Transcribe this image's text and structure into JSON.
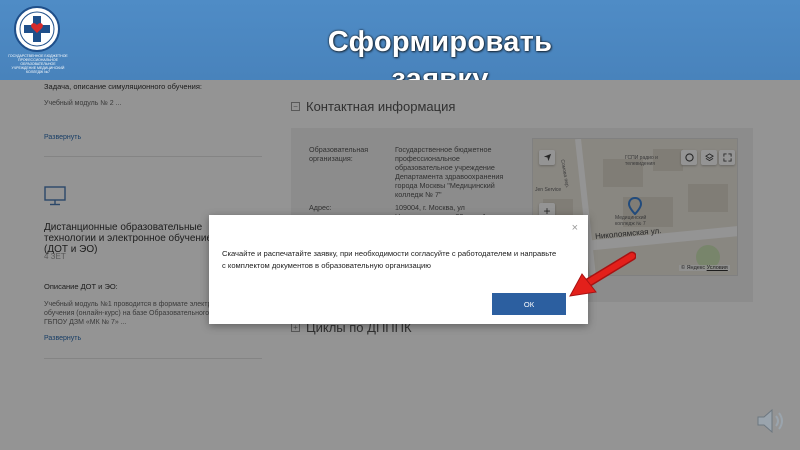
{
  "slide": {
    "title_line1": "Сформировать",
    "title_line2": "заявку",
    "logo_caption": "ГОСУДАРСТВЕННОЕ БЮДЖЕТНОЕ ПРОФЕССИОНАЛЬНОЕ ОБРАЗОВАТЕЛЬНОЕ УЧРЕЖДЕНИЕ МЕДИЦИНСКИЙ КОЛЛЕДЖ №7"
  },
  "left_panel": {
    "task_label": "Задача, описание симуляционного обучения:",
    "task_value": "Учебный модуль № 2 ...",
    "expand_1": "Развернуть",
    "course_title": "Дистанционные образовательные технологии и электронное обучение (ДОТ и ЭО)",
    "course_credits": "4 ЗЕТ",
    "dot_label": "Описание ДОТ и ЭО:",
    "dot_value": "Учебный модуль №1 проводится в формате электронного обучения (онлайн-курс) на базе Образовательного портала ГБПОУ ДЗМ «МК № 7» ...",
    "expand_2": "Развернуть"
  },
  "contact": {
    "section_title": "Контактная информация",
    "org_label": "Образовательная организация:",
    "org_value": "Государственное бюджетное профессиональное образовательное учреждение Департамента здравоохранения города Москвы \"Медицинский колледж № 7\"",
    "address_label": "Адрес:",
    "address_value": "109004, г. Москва, ул Николоямская, д. 22, стр. 1"
  },
  "map": {
    "street_label": "Николоямская ул.",
    "poi_1": "ГСПИ радио и телевидения",
    "poi_2": "Медицинский колледж № 7",
    "poi_3": "Jen Service",
    "side_street": "Сомова пер.",
    "yandex": "© Яндекс",
    "terms": "Условия"
  },
  "cycles": {
    "section_title": "Циклы по ДПППК"
  },
  "modal": {
    "close_symbol": "×",
    "message": "Скачайте и распечатайте заявку, при необходимости согласуйте с работодателем и направьте с комплектом документов в образовательную организацию",
    "ok_label": "ОК"
  },
  "colors": {
    "accent": "#2c5fa0",
    "arrow": "#e3201b"
  }
}
